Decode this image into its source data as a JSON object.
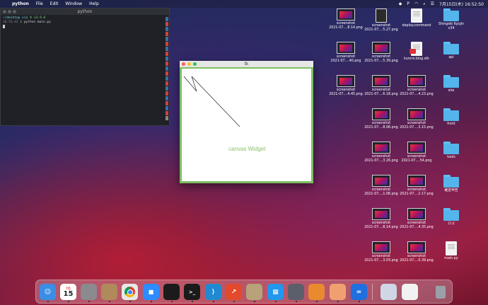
{
  "menubar": {
    "app_name": "python",
    "items": [
      "File",
      "Edit",
      "Window",
      "Help"
    ],
    "clock": "7月15日(木) 16:52:50"
  },
  "terminal": {
    "title": "python",
    "prompt_path": "~/desktop via",
    "prompt_extra": "v3.9.6",
    "prompt_time": "16:52:42",
    "command": "python main.py"
  },
  "tk": {
    "title": "tk",
    "canvas_label": "canvas Widget"
  },
  "desktop": {
    "icons": [
      {
        "type": "thumb",
        "line1": "screenshot",
        "line2": "2021-07....8.14.png"
      },
      {
        "type": "darkdoc",
        "line1": "screenshot",
        "line2": "2021-07....5.27.png"
      },
      {
        "type": "doc",
        "line1": "deploy.command",
        "line2": ""
      },
      {
        "type": "folder",
        "line1": "Shingeki Kyojin",
        "line2": "v34"
      },
      {
        "type": "thumb",
        "line1": "screenshot",
        "line2": "2021-07....40.png"
      },
      {
        "type": "thumb",
        "line1": "screenshot",
        "line2": "2021-07....5.39.png"
      },
      {
        "type": "pdfdoc",
        "line1": "kuroro.blog.stk",
        "line2": ""
      },
      {
        "type": "folder",
        "line1": "api",
        "line2": ""
      },
      {
        "type": "thumb",
        "line1": "screenshot",
        "line2": "2021-07....4.45.png"
      },
      {
        "type": "thumb",
        "line1": "screenshot",
        "line2": "2021-07....6.18.png"
      },
      {
        "type": "thumb",
        "line1": "screenshot",
        "line2": "2021-07....4.23.png"
      },
      {
        "type": "folder",
        "line1": "site",
        "line2": ""
      },
      {
        "type": "thumb",
        "line1": "screenshot",
        "line2": "2021-07....8.06.png"
      },
      {
        "type": "thumb",
        "line1": "screenshot",
        "line2": "2021-07....3.15.png"
      },
      {
        "type": "folder",
        "line1": "front",
        "line2": ""
      },
      {
        "type": "thumb",
        "line1": "screenshot",
        "line2": "2021-07....3.26.png"
      },
      {
        "type": "thumb",
        "line1": "screenshot",
        "line2": "2021-07....54.png"
      },
      {
        "type": "folder",
        "line1": "tools",
        "line2": ""
      },
      {
        "type": "thumb",
        "line1": "screenshot",
        "line2": "2021-07....1.06.png"
      },
      {
        "type": "thumb",
        "line1": "screenshot",
        "line2": "2021-07....2.17.png"
      },
      {
        "type": "folder",
        "line1": "確定申告",
        "line2": ""
      },
      {
        "type": "thumb",
        "line1": "screenshot",
        "line2": "2021-07....8.14.png"
      },
      {
        "type": "thumb",
        "line1": "screenshot",
        "line2": "2021-07....4.35.png"
      },
      {
        "type": "folder",
        "line1": "ロゴ",
        "line2": ""
      },
      {
        "type": "thumb",
        "line1": "screenshot",
        "line2": "2021-07....3.03.png"
      },
      {
        "type": "thumb",
        "line1": "screenshot",
        "line2": "2021-07....0.39.png"
      },
      {
        "type": "doc",
        "line1": "main.py",
        "line2": ""
      }
    ]
  },
  "dock": {
    "calendar_month": "7月",
    "calendar_day": "15",
    "items": [
      {
        "name": "finder-icon",
        "color": "#3a8ee6"
      },
      {
        "name": "calendar-icon",
        "color": "#ffffff"
      },
      {
        "name": "system-preferences-icon",
        "color": "#8a8a8f"
      },
      {
        "name": "contacts-icon",
        "color": "#b08a5a"
      },
      {
        "name": "chrome-icon",
        "color": "#e8e8e8"
      },
      {
        "name": "zoom-icon",
        "color": "#2d8cff"
      },
      {
        "name": "activity-monitor-icon",
        "color": "#1b1b1b"
      },
      {
        "name": "terminal-icon",
        "color": "#1b1b1b"
      },
      {
        "name": "vscode-icon",
        "color": "#1f8ad2"
      },
      {
        "name": "grapher-icon",
        "color": "#e24a2b"
      },
      {
        "name": "archive-utility-icon",
        "color": "#b7a27a"
      },
      {
        "name": "docker-icon",
        "color": "#2396ed"
      },
      {
        "name": "quicktime-icon",
        "color": "#5a5f6b"
      },
      {
        "name": "network-app-icon",
        "color": "#e98a2e"
      },
      {
        "name": "python-launcher-icon",
        "color": "#f0a070"
      },
      {
        "name": "infinity-app-icon",
        "color": "#1e6fe0"
      },
      {
        "name": "preview-icon",
        "color": "#cfd7e6"
      },
      {
        "name": "document-icon",
        "color": "#f2f2f2"
      },
      {
        "name": "trash-icon",
        "color": "#8e9096"
      }
    ]
  }
}
